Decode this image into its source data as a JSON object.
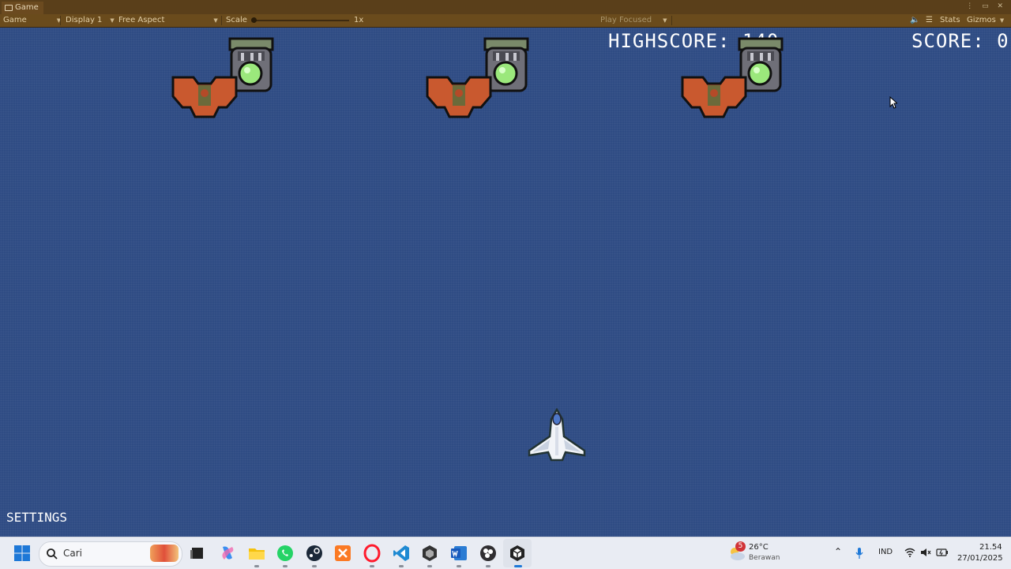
{
  "editor": {
    "tab_title": "Game",
    "toolbar": {
      "view_mode": "Game",
      "display": "Display 1",
      "aspect": "Free Aspect",
      "scale_label": "Scale",
      "scale_value": "1x",
      "play_focused": "Play Focused",
      "stats": "Stats",
      "gizmos": "Gizmos"
    }
  },
  "game": {
    "highscore_label": "HIGHSCORE:",
    "highscore_value": "140",
    "score_label": "SCORE:",
    "score_value": "0",
    "settings_label": "SETTINGS",
    "enemy_groups": 3
  },
  "taskbar": {
    "search_placeholder": "Cari",
    "weather_badge": "5",
    "weather_temp": "26°C",
    "weather_desc": "Berawan",
    "language": "IND",
    "time": "21.54",
    "date": "27/01/2025",
    "apps": [
      "start-icon",
      "search-icon",
      "widgets-icon",
      "task-view-icon",
      "copilot-icon",
      "file-explorer-icon",
      "whatsapp-icon",
      "steam-icon",
      "xampp-icon",
      "opera-icon",
      "vscode-icon",
      "unity-hub-icon",
      "word-icon",
      "obs-icon",
      "unity-icon"
    ]
  }
}
